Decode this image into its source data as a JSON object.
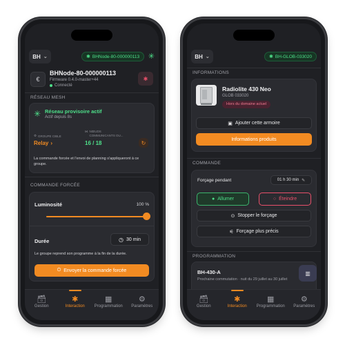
{
  "left": {
    "bh_selector": "BH",
    "node_pill": "BHNode-80-000000113",
    "node": {
      "name": "BHNode-80-000000113",
      "firmware": "Firmware 0.4.0-master+44",
      "status": "Connecté"
    },
    "mesh_section": "RÉSEAU MESH",
    "mesh": {
      "title": "Réseau provisoire actif",
      "since": "Actif depuis 8s",
      "target_group_label": "GROUPE CIBLE",
      "target_group_value": "Relay",
      "nodes_label_1": "NŒUDS",
      "nodes_label_2": "COMMUNICANTS OU...",
      "nodes_value": "16 / 18",
      "note": "La commande forcée et l'envoi de planning s'appliqueront à ce groupe."
    },
    "forced_section": "COMMANDE FORCÉE",
    "forced": {
      "brightness_label": "Luminosité",
      "brightness_value": "100 %",
      "brightness_level": 1.0,
      "duration_label": "Durée",
      "duration_value": "30 min",
      "note": "Le groupe reprend son programme à la fin de la durée.",
      "send_button": "Envoyer la commande forcée"
    }
  },
  "right": {
    "bh_selector": "BH",
    "node_pill": "BH-GLOB-033020",
    "info_section": "INFORMATIONS",
    "product": {
      "name": "Radiolite 430 Neo",
      "id": "GLOB 033020",
      "badge": "Hors du domaine actuel",
      "add_button": "Ajouter cette armoire",
      "info_button": "Informations produits"
    },
    "command_section": "COMMANDE",
    "command": {
      "force_label": "Forçage pendant",
      "force_value": "01 h 30 min",
      "on_button": "Allumer",
      "off_button": "Éteindre",
      "stop_button": "Stopper le forçage",
      "precise_button": "Forçage plus précis"
    },
    "program_section": "PROGRAMMATION",
    "program": {
      "name": "BH-430-A",
      "next": "Prochaine commutation · nuit du 29 juillet au 30 juillet"
    }
  },
  "tabs": [
    {
      "label": "Gestion",
      "icon": "archive-icon"
    },
    {
      "label": "Interaction",
      "icon": "bluetooth-icon"
    },
    {
      "label": "Programmation",
      "icon": "calendar-icon"
    },
    {
      "label": "Paramètres",
      "icon": "person-gear-icon"
    }
  ],
  "colors": {
    "accent": "#f28b22",
    "green": "#4ee08a",
    "red": "#e8506a",
    "background": "#1f2024",
    "card": "#2a2b30"
  }
}
